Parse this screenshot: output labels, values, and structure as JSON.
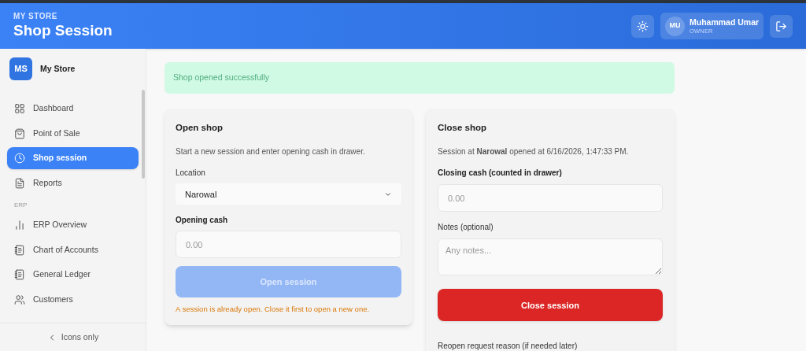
{
  "header": {
    "store": "MY STORE",
    "title": "Shop Session",
    "user": {
      "initials": "MU",
      "name": "Muhammad Umar",
      "role": "OWNER"
    }
  },
  "sidebar": {
    "brand": {
      "initials": "MS",
      "name": "My Store"
    },
    "groups": [
      {
        "items": [
          {
            "label": "Dashboard",
            "selected": false
          },
          {
            "label": "Point of Sale",
            "selected": false
          },
          {
            "label": "Shop session",
            "selected": true
          },
          {
            "label": "Reports",
            "selected": false
          }
        ]
      },
      {
        "label": "ERP",
        "items": [
          {
            "label": "ERP Overview",
            "selected": false
          },
          {
            "label": "Chart of Accounts",
            "selected": false
          },
          {
            "label": "General Ledger",
            "selected": false
          },
          {
            "label": "Customers",
            "selected": false
          }
        ]
      }
    ],
    "footer": "Icons only"
  },
  "alert": "Shop opened successfully",
  "open_shop": {
    "title": "Open shop",
    "description": "Start a new session and enter opening cash in drawer.",
    "location_label": "Location",
    "location_value": "Narowal",
    "cash_label": "Opening cash",
    "cash_placeholder": "0.00",
    "button": {
      "label": "Open session",
      "disabled": true
    },
    "warning": "A session is already open. Close it first to open a new one."
  },
  "close_shop": {
    "title": "Close shop",
    "description": "Session at **Narowal** opened at 6/16/2026, 1:47:33 PM.",
    "cash_label": "Closing cash (counted in drawer)",
    "cash_placeholder": "0.00",
    "notes_label": "Notes (optional)",
    "notes_placeholder": "Any notes...",
    "button": {
      "label": "Close session",
      "disabled": false
    },
    "reopen_label": "Reopen request reason (if needed later)"
  }
}
